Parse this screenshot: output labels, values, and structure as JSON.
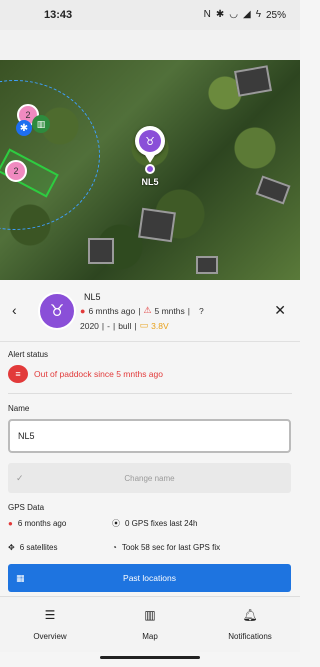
{
  "status_bar": {
    "time": "13:43",
    "battery": "25%",
    "icons": [
      "nfc-icon",
      "bluetooth-icon",
      "wifi-icon",
      "signal-icon",
      "battery-charging-icon"
    ]
  },
  "map": {
    "clusters": [
      {
        "count": "2",
        "color": "#f08ac0"
      },
      {
        "count": "2",
        "color": "#f08ac0"
      }
    ],
    "animal_marker_label": "NL5",
    "marker_color": "#8a4fd8",
    "geofence_color": "#3fa0ff",
    "paddock_color": "#2ecc40"
  },
  "animal": {
    "name": "NL5",
    "last_seen": "6 mnths ago",
    "last_signal": "5 mnths",
    "unknown": "?",
    "year": "2020",
    "sex": "-",
    "type": "bull",
    "battery": "3.8V"
  },
  "alert": {
    "title": "Alert status",
    "text": "Out of paddock since 5 mnths ago",
    "color": "#e23a3a"
  },
  "name_section": {
    "title": "Name",
    "value": "NL5",
    "change_label": "Change name"
  },
  "gps": {
    "title": "GPS Data",
    "last_fix": "6 months ago",
    "fixes_24h": "0 GPS fixes last 24h",
    "satellites": "6 satellites",
    "fix_time": "Took 58 sec for last GPS fix",
    "past_locations_label": "Past locations"
  },
  "nav": {
    "overview": "Overview",
    "map": "Map",
    "notifications": "Notifications"
  },
  "colors": {
    "accent": "#1e74e0",
    "alert": "#e23a3a",
    "battery": "#e8a11a"
  }
}
